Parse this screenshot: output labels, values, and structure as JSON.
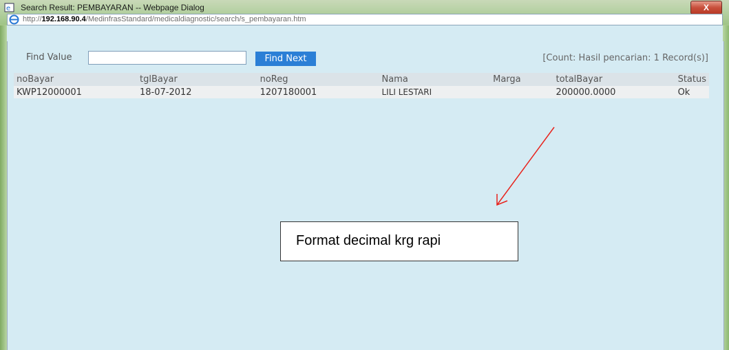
{
  "window": {
    "title": "Search Result: PEMBAYARAN -- Webpage Dialog",
    "close_label": "X",
    "url_prefix": "http://",
    "url_host": "192.168.90.4",
    "url_path": "/MedinfrasStandard/medicaldiagnostic/search/s_pembayaran.htm"
  },
  "search": {
    "label": "Find Value",
    "value": "",
    "button_label": "Find Next",
    "count_text": "[Count: Hasil pencarian: 1 Record(s)]"
  },
  "table": {
    "columns": [
      "noBayar",
      "tglBayar",
      "noReg",
      "Nama",
      "Marga",
      "totalBayar",
      "Status"
    ],
    "rows": [
      {
        "noBayar": "KWP12000001",
        "tglBayar": "18-07-2012",
        "noReg": "1207180001",
        "Nama": "LILI LESTARI",
        "Marga": "",
        "totalBayar": "200000.0000",
        "Status": "Ok"
      }
    ]
  },
  "annotation": {
    "text": "Format decimal krg rapi",
    "arrow_color": "#e8231c"
  }
}
